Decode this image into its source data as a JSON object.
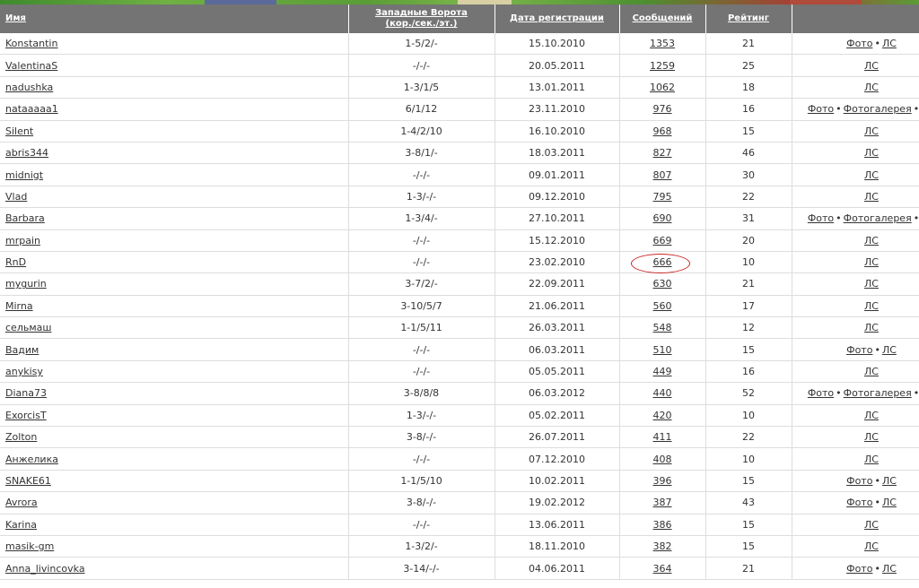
{
  "header": {
    "name": "Имя",
    "gate_line1": "Западные Ворота",
    "gate_line2": "(кор./сек./эт.)",
    "reg_date": "Дата регистрации",
    "messages": "Сообщений",
    "rating": "Рейтинг"
  },
  "link_labels": {
    "photo": "Фото",
    "gallery": "Фотогалерея",
    "pm": "ЛС",
    "sep": "•"
  },
  "rows": [
    {
      "name": "Konstantin",
      "gate": "1-5/2/-",
      "date": "15.10.2010",
      "messages": "1353",
      "rating": "21",
      "links": [
        "photo",
        "pm"
      ]
    },
    {
      "name": "ValentinaS",
      "gate": "-/-/-",
      "date": "20.05.2011",
      "messages": "1259",
      "rating": "25",
      "links": [
        "pm"
      ]
    },
    {
      "name": "nadushka",
      "gate": "1-3/1/5",
      "date": "13.01.2011",
      "messages": "1062",
      "rating": "18",
      "links": [
        "pm"
      ]
    },
    {
      "name": "nataaaaa1",
      "gate": "6/1/12",
      "date": "23.11.2010",
      "messages": "976",
      "rating": "16",
      "links": [
        "photo",
        "gallery",
        "pm"
      ]
    },
    {
      "name": "Silent",
      "gate": "1-4/2/10",
      "date": "16.10.2010",
      "messages": "968",
      "rating": "15",
      "links": [
        "pm"
      ]
    },
    {
      "name": "abris344",
      "gate": "3-8/1/-",
      "date": "18.03.2011",
      "messages": "827",
      "rating": "46",
      "links": [
        "pm"
      ]
    },
    {
      "name": "midnigt",
      "gate": "-/-/-",
      "date": "09.01.2011",
      "messages": "807",
      "rating": "30",
      "links": [
        "pm"
      ]
    },
    {
      "name": "Vlad",
      "gate": "1-3/-/-",
      "date": "09.12.2010",
      "messages": "795",
      "rating": "22",
      "links": [
        "pm"
      ]
    },
    {
      "name": "Barbara",
      "gate": "1-3/4/-",
      "date": "27.10.2011",
      "messages": "690",
      "rating": "31",
      "links": [
        "photo",
        "gallery",
        "pm"
      ]
    },
    {
      "name": "mrpain",
      "gate": "-/-/-",
      "date": "15.12.2010",
      "messages": "669",
      "rating": "20",
      "links": [
        "pm"
      ]
    },
    {
      "name": "RnD",
      "gate": "-/-/-",
      "date": "23.02.2010",
      "messages": "666",
      "rating": "10",
      "links": [
        "pm"
      ]
    },
    {
      "name": "mygurin",
      "gate": "3-7/2/-",
      "date": "22.09.2011",
      "messages": "630",
      "rating": "21",
      "links": [
        "pm"
      ]
    },
    {
      "name": "Mirna",
      "gate": "3-10/5/7",
      "date": "21.06.2011",
      "messages": "560",
      "rating": "17",
      "links": [
        "pm"
      ]
    },
    {
      "name": "сельмаш",
      "gate": "1-1/5/11",
      "date": "26.03.2011",
      "messages": "548",
      "rating": "12",
      "links": [
        "pm"
      ]
    },
    {
      "name": "Вадим",
      "gate": "-/-/-",
      "date": "06.03.2011",
      "messages": "510",
      "rating": "15",
      "links": [
        "photo",
        "pm"
      ]
    },
    {
      "name": "anykisy",
      "gate": "-/-/-",
      "date": "05.05.2011",
      "messages": "449",
      "rating": "16",
      "links": [
        "pm"
      ]
    },
    {
      "name": "Diana73",
      "gate": "3-8/8/8",
      "date": "06.03.2012",
      "messages": "440",
      "rating": "52",
      "links": [
        "photo",
        "gallery",
        "pm"
      ]
    },
    {
      "name": "ExorcisT",
      "gate": "1-3/-/-",
      "date": "05.02.2011",
      "messages": "420",
      "rating": "10",
      "links": [
        "pm"
      ]
    },
    {
      "name": "Zolton",
      "gate": "3-8/-/-",
      "date": "26.07.2011",
      "messages": "411",
      "rating": "22",
      "links": [
        "pm"
      ]
    },
    {
      "name": "Анжелика",
      "gate": "-/-/-",
      "date": "07.12.2010",
      "messages": "408",
      "rating": "10",
      "links": [
        "pm"
      ]
    },
    {
      "name": "SNAKE61",
      "gate": "1-1/5/10",
      "date": "10.02.2011",
      "messages": "396",
      "rating": "15",
      "links": [
        "photo",
        "pm"
      ]
    },
    {
      "name": "Avrora",
      "gate": "3-8/-/-",
      "date": "19.02.2012",
      "messages": "387",
      "rating": "43",
      "links": [
        "photo",
        "pm"
      ]
    },
    {
      "name": "Karina",
      "gate": "-/-/-",
      "date": "13.06.2011",
      "messages": "386",
      "rating": "15",
      "links": [
        "pm"
      ]
    },
    {
      "name": "masik-gm",
      "gate": "1-3/2/-",
      "date": "18.11.2010",
      "messages": "382",
      "rating": "15",
      "links": [
        "pm"
      ]
    },
    {
      "name": "Anna_livincovka",
      "gate": "3-14/-/-",
      "date": "04.06.2011",
      "messages": "364",
      "rating": "21",
      "links": [
        "photo",
        "pm"
      ]
    }
  ],
  "colors": {
    "header_bg": "#747474",
    "highlight_circle": "#cc2222",
    "row_border": "#dddddd"
  }
}
